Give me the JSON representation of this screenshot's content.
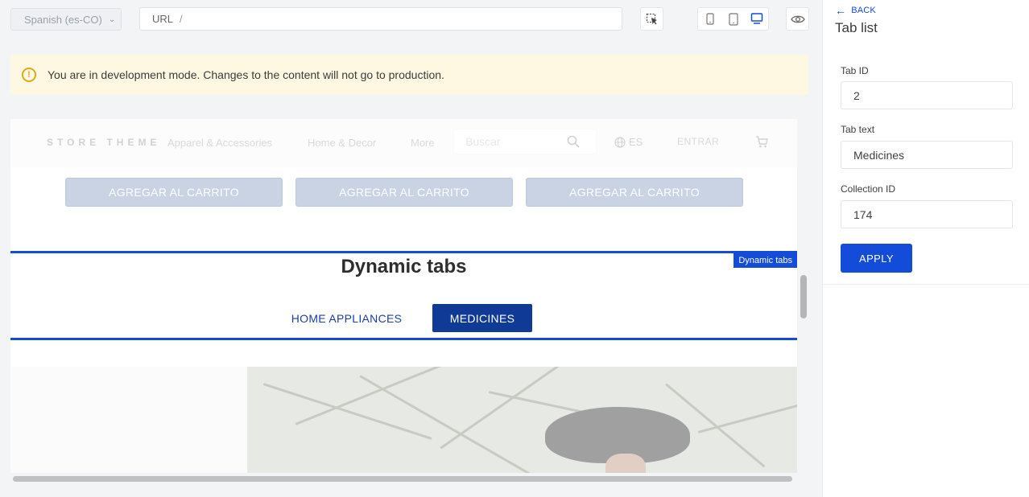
{
  "toolbar": {
    "locale": "Spanish (es-CO)",
    "url_label": "URL",
    "url_value": "/"
  },
  "banner": {
    "message": "You are in development mode. Changes to the content will not go to production."
  },
  "preview": {
    "store_header": {
      "logo": "STORE THEME",
      "nav": [
        "Apparel & Accessories",
        "Home & Decor",
        "More"
      ],
      "search_placeholder": "Buscar",
      "language": "ES",
      "login": "ENTRAR"
    },
    "add_to_cart_buttons": [
      "AGREGAR AL CARRITO",
      "AGREGAR AL CARRITO",
      "AGREGAR AL CARRITO"
    ],
    "tabs_block": {
      "label": "Dynamic tabs",
      "title": "Dynamic tabs",
      "tabs": [
        "HOME APPLIANCES",
        "MEDICINES"
      ],
      "active_tab": "MEDICINES"
    }
  },
  "panel": {
    "back_label": "BACK",
    "title": "Tab list",
    "fields": [
      {
        "label": "Tab ID",
        "value": "2"
      },
      {
        "label": "Tab text",
        "value": "Medicines"
      },
      {
        "label": "Collection ID",
        "value": "174"
      }
    ],
    "apply_label": "APPLY"
  },
  "colors": {
    "accent": "#134cd8",
    "active_tab": "#0f3a96",
    "banner_bg": "#fef7e1",
    "warning": "#e0a81a"
  }
}
